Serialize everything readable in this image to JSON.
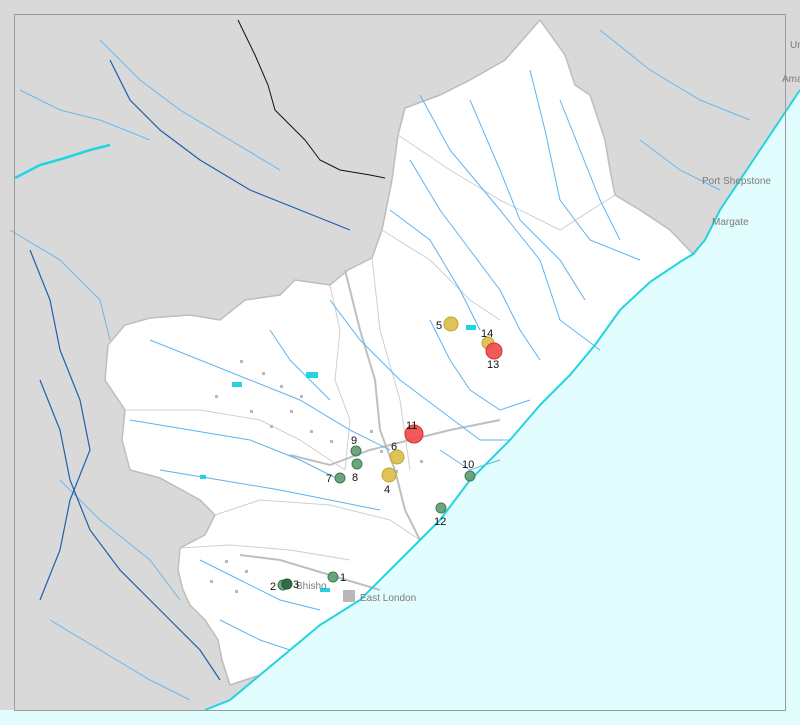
{
  "map": {
    "colors": {
      "sea": "#e1fdfd",
      "outside_land": "#d9d9d9",
      "region": "#ffffff",
      "coastline": "#22d3e2",
      "rivers": "#5fb3f0",
      "major_rivers": "#1f5fae",
      "borders": "#b9b9b9",
      "green_site": "#5c9a6e",
      "dark_green_site": "#2f6e47",
      "yellow_site": "#d9b93c",
      "red_site": "#f04848"
    },
    "towns": [
      {
        "id": "port-shepstone",
        "name": "Port Shepstone"
      },
      {
        "id": "margate",
        "name": "Margate"
      },
      {
        "id": "east-london",
        "name": "East London"
      },
      {
        "id": "bhisho",
        "name": "Bhisho"
      },
      {
        "id": "um",
        "name": "Um"
      },
      {
        "id": "amar",
        "name": "Amar"
      }
    ],
    "sites": [
      {
        "id": "1",
        "label": "1",
        "category": "green"
      },
      {
        "id": "2",
        "label": "2",
        "category": "green"
      },
      {
        "id": "3",
        "label": "3",
        "category": "dark-green"
      },
      {
        "id": "4",
        "label": "4",
        "category": "yellow"
      },
      {
        "id": "5",
        "label": "5",
        "category": "yellow"
      },
      {
        "id": "6",
        "label": "6",
        "category": "yellow"
      },
      {
        "id": "7",
        "label": "7",
        "category": "green"
      },
      {
        "id": "8",
        "label": "8",
        "category": "green"
      },
      {
        "id": "9",
        "label": "9",
        "category": "green"
      },
      {
        "id": "10",
        "label": "10",
        "category": "green"
      },
      {
        "id": "11",
        "label": "11",
        "category": "red"
      },
      {
        "id": "12",
        "label": "12",
        "category": "green"
      },
      {
        "id": "13",
        "label": "13",
        "category": "red"
      },
      {
        "id": "14",
        "label": "14",
        "category": "yellow"
      }
    ]
  }
}
